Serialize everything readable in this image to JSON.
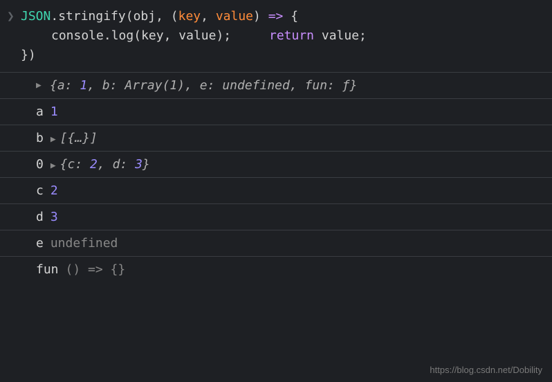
{
  "input": {
    "l1": {
      "json": "JSON",
      "dot1": ".",
      "stringify": "stringify",
      "open": "(",
      "obj": "obj",
      "comma": ", (",
      "key": "key",
      "comma2": ", ",
      "value": "value",
      "close_arrow": ") ",
      "arrow": "=>",
      "brace": " {"
    },
    "l2": {
      "console": "console",
      "dot": ".",
      "log": "log",
      "open": "(",
      "key": "key",
      "comma": ", ",
      "value": "value",
      "close": ")",
      "semi": ";"
    },
    "l3": {
      "return": "return",
      "value": " value",
      "semi": ";"
    },
    "l4": {
      "close": "})"
    }
  },
  "output": {
    "obj_preview": {
      "open": "{",
      "a_key": "a: ",
      "a_val": "1",
      "c1": ", ",
      "b_key": "b: ",
      "b_val": "Array(1)",
      "c2": ", ",
      "e_key": "e: ",
      "e_val": "undefined",
      "c3": ", ",
      "fun_key": "fun: ",
      "fun_val": "ƒ",
      "close": "}"
    },
    "row_a": {
      "key": "a",
      "val": "1"
    },
    "row_b": {
      "key": "b",
      "val": "[{…}]"
    },
    "row_0": {
      "key": "0",
      "open": "{",
      "c_key": "c: ",
      "c_val": "2",
      "comma": ", ",
      "d_key": "d: ",
      "d_val": "3",
      "close": "}"
    },
    "row_c": {
      "key": "c",
      "val": "2"
    },
    "row_d": {
      "key": "d",
      "val": "3"
    },
    "row_e": {
      "key": "e",
      "val": "undefined"
    },
    "row_fun": {
      "key": "fun",
      "val": "() => {}"
    }
  },
  "watermark": "https://blog.csdn.net/Dobility"
}
